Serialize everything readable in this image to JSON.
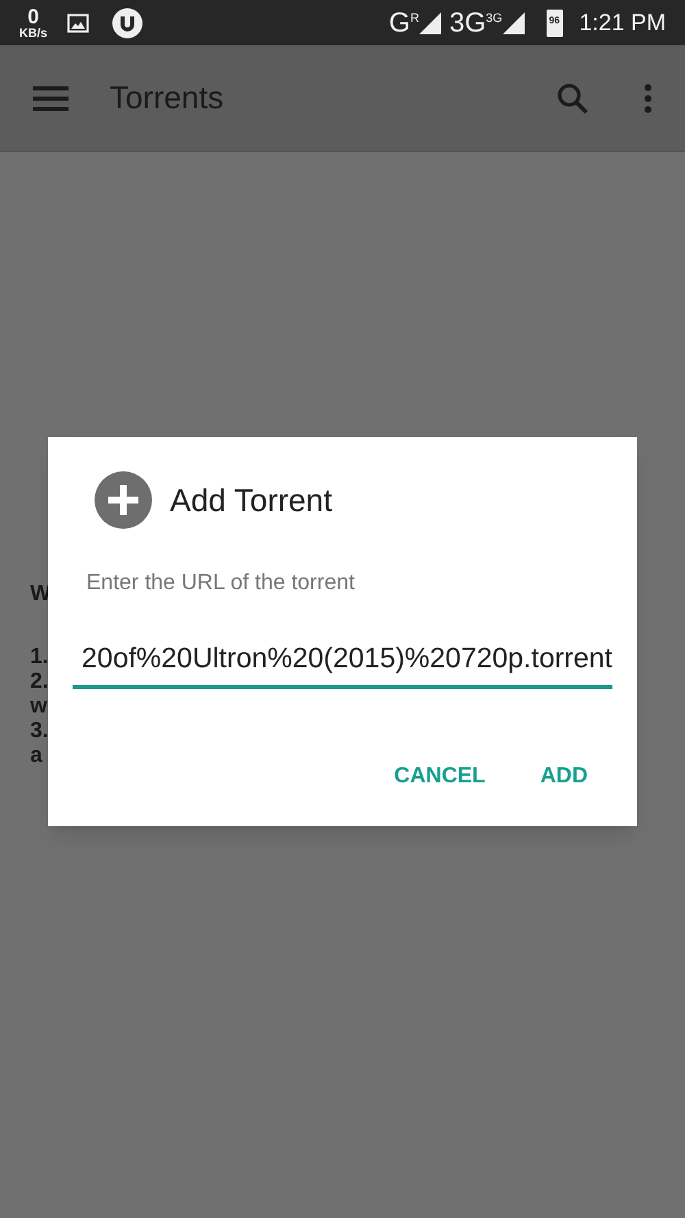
{
  "status_bar": {
    "speed_value": "0",
    "speed_unit": "KB/s",
    "network_1": "G",
    "network_1_sup": "R",
    "network_2": "3G",
    "network_2_sup": "3G",
    "battery": "96",
    "time": "1:21 PM"
  },
  "toolbar": {
    "title": "Torrents"
  },
  "background_text": {
    "heading": "W",
    "lines": [
      "1.",
      "2.",
      "w",
      "3.",
      "a"
    ]
  },
  "dialog": {
    "title": "Add Torrent",
    "prompt": "Enter the URL of the torrent",
    "url_value": "20of%20Ultron%20(2015)%20720p.torrent",
    "buttons": [
      "CANCEL",
      "ADD"
    ]
  }
}
